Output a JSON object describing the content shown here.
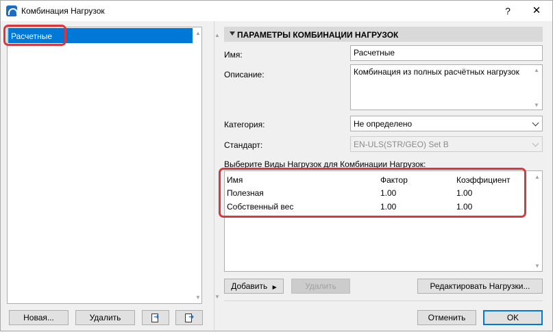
{
  "window": {
    "title": "Комбинация Нагрузок",
    "help_label": "?",
    "close_label": "✕"
  },
  "left": {
    "items": [
      {
        "label": "Расчетные",
        "selected": true
      }
    ],
    "new_button": "Новая...",
    "delete_button": "Удалить"
  },
  "right": {
    "section_title": "ПАРАМЕТРЫ КОМБИНАЦИИ НАГРУЗОК",
    "name_label": "Имя:",
    "name_value": "Расчетные",
    "description_label": "Описание:",
    "description_value": "Комбинация из полных расчётных нагрузок",
    "category_label": "Категория:",
    "category_value": "Не определено",
    "standard_label": "Стандарт:",
    "standard_value": "EN-ULS(STR/GEO) Set B",
    "select_label": "Выберите Виды Нагрузок для Комбинации Нагрузок:",
    "table": {
      "columns": [
        "Имя",
        "Фактор",
        "Коэффициент"
      ],
      "rows": [
        {
          "name": "Полезная",
          "factor": "1.00",
          "coef": "1.00"
        },
        {
          "name": "Собственный вес",
          "factor": "1.00",
          "coef": "1.00"
        }
      ]
    },
    "add_button": "Добавить",
    "remove_button": "Удалить",
    "edit_loads_button": "Редактировать Нагрузки...",
    "cancel_button": "Отменить",
    "ok_button": "OK"
  },
  "colors": {
    "selection": "#0078d7",
    "highlight": "#d9363e",
    "header_bg": "#d9d9d9"
  },
  "icons": [
    "app-icon",
    "import-icon",
    "export-icon",
    "chevron-down-icon",
    "triangle-down-icon",
    "scroll-up-icon",
    "scroll-down-icon"
  ]
}
